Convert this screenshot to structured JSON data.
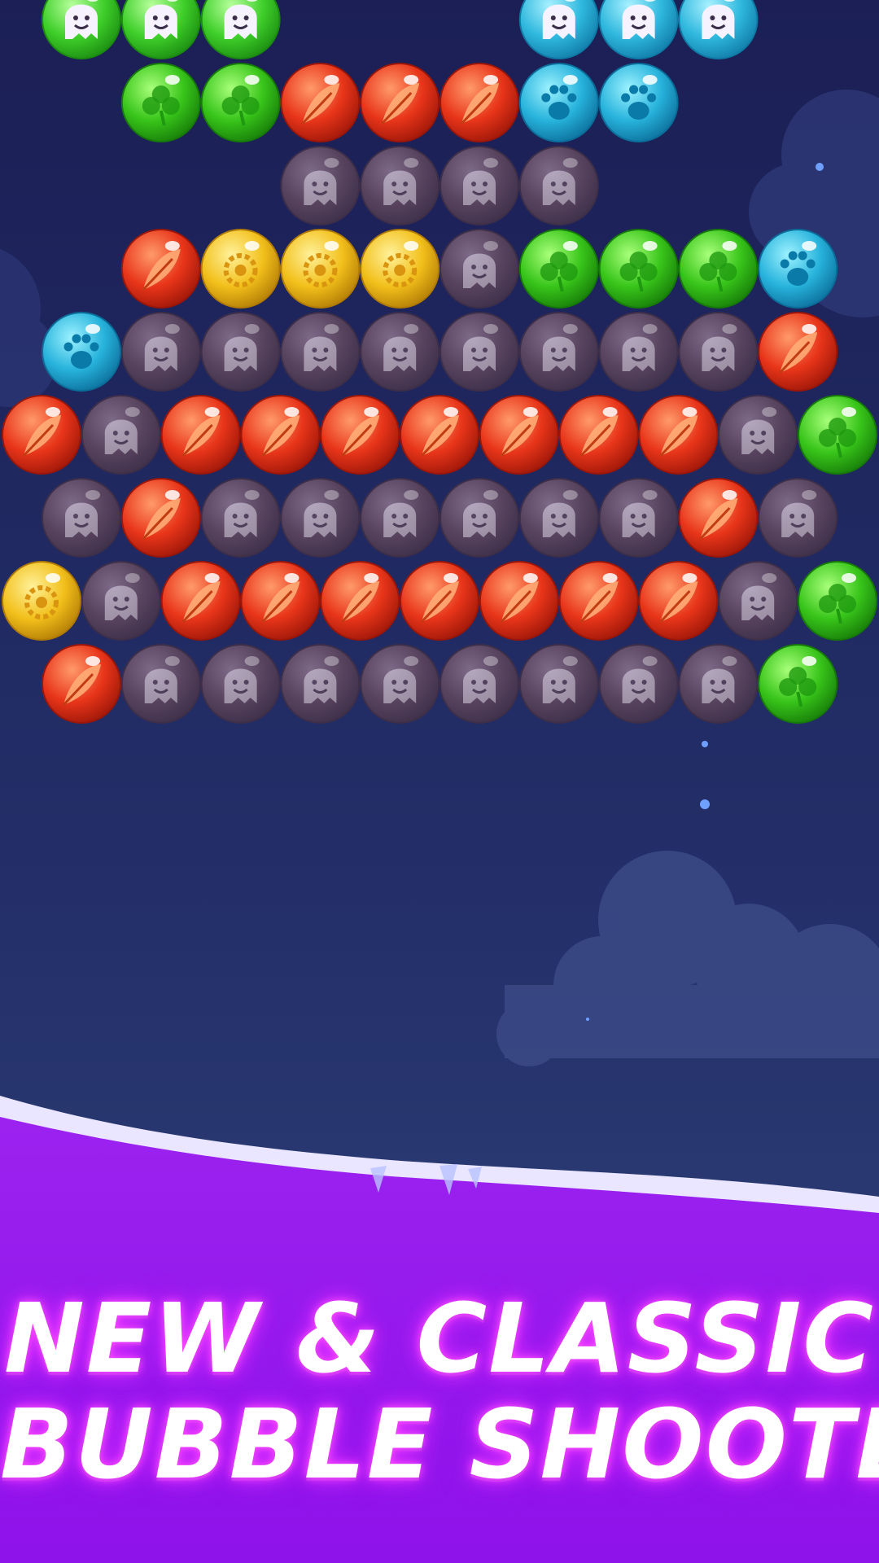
{
  "promo": {
    "line1": "NEW & CLASSIC",
    "line2": "BUBBLE SHOOTER"
  },
  "colors": {
    "sky_top": "#1b1f55",
    "sky_bottom": "#2d3d74",
    "banner_purple": "#9a1fee",
    "snow": "#e9e4ff",
    "glow": "#e236ff"
  },
  "bubble_types": {
    "red": {
      "icon": "feather-icon",
      "base": "#e8351a",
      "light": "#ff9a6a",
      "dark": "#9b1608"
    },
    "green": {
      "icon": "clover-icon",
      "base": "#38c51a",
      "light": "#a8ff7a",
      "dark": "#167a08"
    },
    "yellow": {
      "icon": "gear-flower-icon",
      "base": "#f2c01b",
      "light": "#fff19a",
      "dark": "#b07a05"
    },
    "blue": {
      "icon": "paw-icon",
      "base": "#27b3dc",
      "light": "#9df2ff",
      "dark": "#0b6d99"
    },
    "ghost": {
      "icon": "ghost-icon",
      "base": "#58435e",
      "light": "#7d6a88",
      "dark": "#3d2f49"
    },
    "ghost_green": {
      "icon": "ghost-icon",
      "base": "#3fcf2a",
      "light": "#b7ff9c",
      "dark": "#1a8a10"
    },
    "ghost_blue": {
      "icon": "ghost-icon",
      "base": "#2fb8de",
      "light": "#a8f1ff",
      "dark": "#0f7aa6"
    }
  },
  "board": {
    "rows": [
      [
        "ghost_green",
        "ghost_green",
        "ghost_green",
        "",
        "",
        "",
        "ghost_blue",
        "ghost_blue",
        "ghost_blue",
        ""
      ],
      [
        "",
        "green",
        "green",
        "red",
        "red",
        "red",
        "blue",
        "blue",
        "",
        ""
      ],
      [
        "",
        "",
        "",
        "ghost",
        "ghost",
        "ghost",
        "ghost",
        "",
        "",
        ""
      ],
      [
        "",
        "red",
        "yellow",
        "yellow",
        "yellow",
        "ghost",
        "green",
        "green",
        "green",
        "blue"
      ],
      [
        "blue",
        "ghost",
        "ghost",
        "ghost",
        "ghost",
        "ghost",
        "ghost",
        "ghost",
        "ghost",
        "red"
      ],
      [
        "red",
        "ghost",
        "red",
        "red",
        "red",
        "red",
        "red",
        "red",
        "red",
        "ghost",
        "green"
      ],
      [
        "ghost",
        "red",
        "ghost",
        "ghost",
        "ghost",
        "ghost",
        "ghost",
        "ghost",
        "red",
        "ghost"
      ],
      [
        "yellow",
        "ghost",
        "red",
        "red",
        "red",
        "red",
        "red",
        "red",
        "red",
        "ghost",
        "green"
      ],
      [
        "red",
        "ghost",
        "ghost",
        "ghost",
        "ghost",
        "ghost",
        "ghost",
        "ghost",
        "ghost",
        "green"
      ]
    ]
  }
}
